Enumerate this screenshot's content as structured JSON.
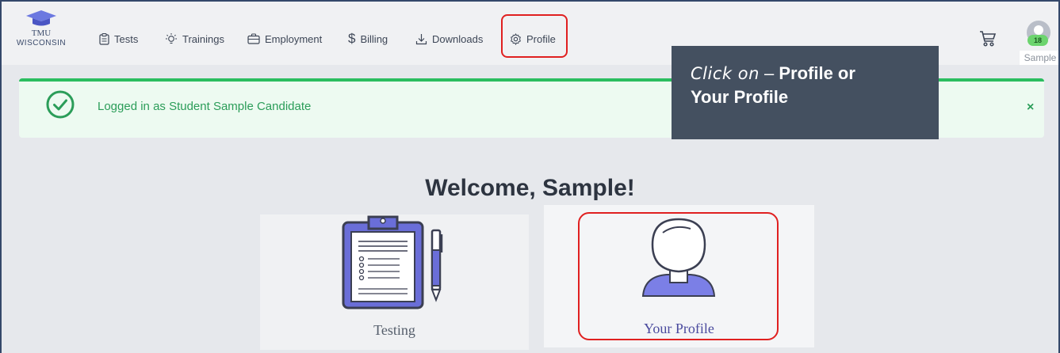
{
  "logo": {
    "title": "TMU",
    "subtitle": "WISCONSIN"
  },
  "nav": {
    "tests": "Tests",
    "trainings": "Trainings",
    "employment": "Employment",
    "billing": "Billing",
    "downloads": "Downloads",
    "profile": "Profile"
  },
  "user": {
    "badge": "18",
    "name": "Sample"
  },
  "alert": {
    "message": "Logged in as Student Sample Candidate",
    "close": "×"
  },
  "callout": {
    "prefix": "Click on",
    "dash": " – ",
    "line1_bold": "Profile or",
    "line2_bold": "Your Profile"
  },
  "welcome": "Welcome, Sample!",
  "cards": {
    "testing": "Testing",
    "profile": "Your Profile"
  },
  "colors": {
    "accent_red": "#e02020",
    "success": "#2bbd5f",
    "callout_bg": "#445060",
    "profile_figure": "#7b7fe6"
  }
}
